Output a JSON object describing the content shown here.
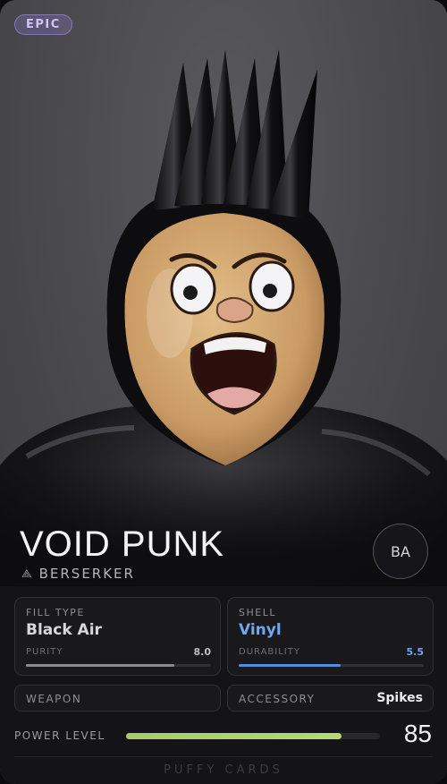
{
  "card": {
    "rarity": "EPIC",
    "name": "VOID PUNK",
    "class_icon": "berserker-icon",
    "class": "BERSERKER",
    "badge": "BA",
    "fill": {
      "label": "FILL TYPE",
      "value": "Black Air",
      "sublabel": "PURITY",
      "subvalue": "8.0",
      "level": 0.8
    },
    "shell": {
      "label": "SHELL",
      "value": "Vinyl",
      "sublabel": "DURABILITY",
      "subvalue": "5.5",
      "level": 0.55
    },
    "weapon": {
      "label": "WEAPON",
      "value": ""
    },
    "accessory": {
      "label": "ACCESSORY",
      "value": "Spikes"
    },
    "power": {
      "label": "POWER LEVEL",
      "value": "85",
      "level": 0.85
    },
    "footer": "PUFFY CARDS"
  },
  "colors": {
    "rarity_accent": "#cfc3ff",
    "shell_accent": "#6ea8f0",
    "power_bar": "#b6d776",
    "card_bg": "#141416"
  }
}
